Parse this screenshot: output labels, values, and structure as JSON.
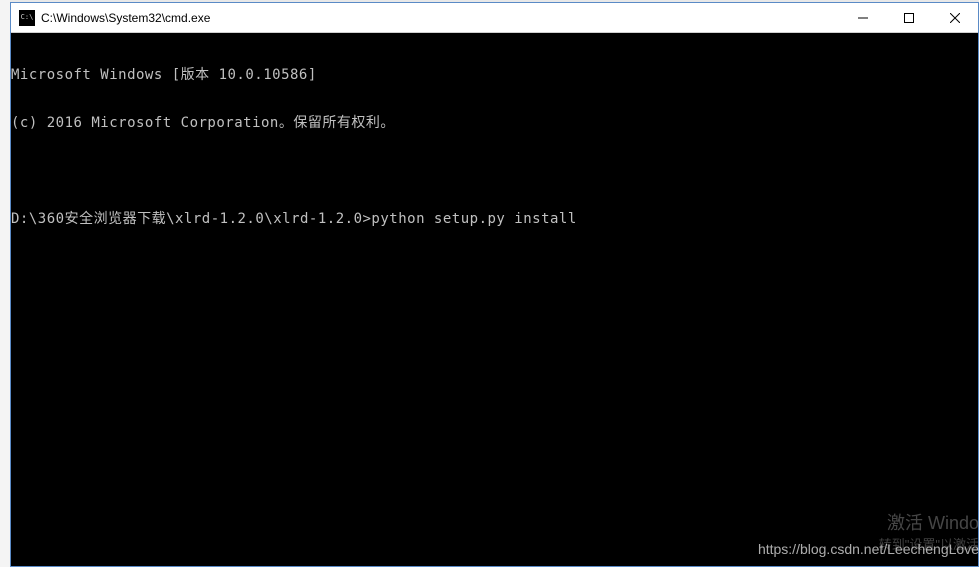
{
  "window": {
    "title": "C:\\Windows\\System32\\cmd.exe"
  },
  "terminal": {
    "lines": [
      "Microsoft Windows [版本 10.0.10586]",
      "(c) 2016 Microsoft Corporation。保留所有权利。",
      "",
      "D:\\360安全浏览器下载\\xlrd-1.2.0\\xlrd-1.2.0>python setup.py install"
    ]
  },
  "watermark": {
    "activate": "激活 Windo",
    "settings": "转到\"设置\"以激活",
    "blog": "https://blog.csdn.net/LeechengLove"
  }
}
